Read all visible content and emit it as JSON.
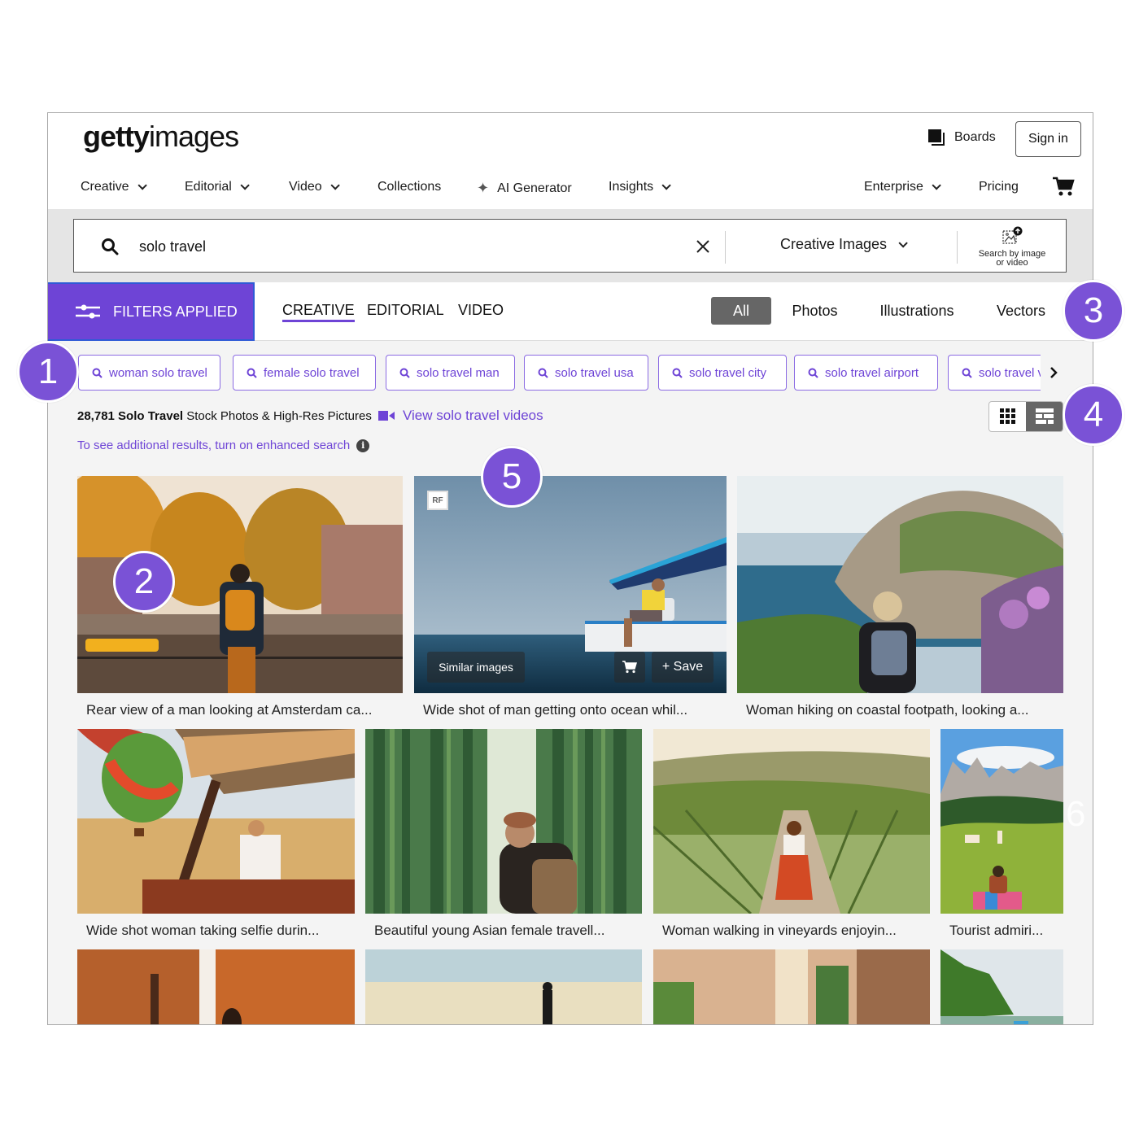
{
  "header": {
    "logo_bold": "getty",
    "logo_light": "images",
    "boards_label": "Boards",
    "signin_label": "Sign in"
  },
  "nav": {
    "items": [
      {
        "label": "Creative",
        "dropdown": true
      },
      {
        "label": "Editorial",
        "dropdown": true
      },
      {
        "label": "Video",
        "dropdown": true
      },
      {
        "label": "Collections",
        "dropdown": false
      },
      {
        "label": "AI Generator",
        "dropdown": false,
        "icon": "sparkle-icon"
      },
      {
        "label": "Insights",
        "dropdown": true
      }
    ],
    "right_items": [
      {
        "label": "Enterprise",
        "dropdown": true
      },
      {
        "label": "Pricing",
        "dropdown": false
      }
    ],
    "cart_icon": "cart-icon"
  },
  "search": {
    "query": "solo travel",
    "scope_label": "Creative Images",
    "search_by_image_label_1": "Search by image",
    "search_by_image_label_2": "or video"
  },
  "filters": {
    "filters_button_label": "FILTERS APPLIED",
    "content_tabs": [
      {
        "label": "CREATIVE",
        "active": true
      },
      {
        "label": "EDITORIAL",
        "active": false
      },
      {
        "label": "VIDEO",
        "active": false
      }
    ],
    "media_types": [
      {
        "label": "All",
        "active": true
      },
      {
        "label": "Photos",
        "active": false
      },
      {
        "label": "Illustrations",
        "active": false
      },
      {
        "label": "Vectors",
        "active": false
      }
    ]
  },
  "suggestions": [
    "woman solo travel",
    "female solo travel",
    "solo travel man",
    "solo travel usa",
    "solo travel city",
    "solo travel airport",
    "solo travel v"
  ],
  "results": {
    "count_bold": "28,781 Solo Travel",
    "count_rest": " Stock Photos & High-Res Pictures",
    "videos_link": "View solo travel videos",
    "enhanced_search_text": "To see additional results, turn on enhanced search",
    "info_glyph": "i",
    "accent_color": "#6e44d6"
  },
  "images": [
    {
      "caption": "Rear view of a man looking at Amsterdam ca..."
    },
    {
      "caption": "Wide shot of man getting onto ocean whil...",
      "badge": "RF",
      "similar_label": "Similar images",
      "save_label": "+ Save"
    },
    {
      "caption": "Woman hiking on coastal footpath, looking a..."
    },
    {
      "caption": "Wide shot woman taking selfie durin..."
    },
    {
      "caption": "Beautiful young Asian female travell..."
    },
    {
      "caption": "Woman walking in vineyards enjoyin..."
    },
    {
      "caption": "Tourist admiri..."
    },
    {
      "caption": ""
    },
    {
      "caption": ""
    },
    {
      "caption": ""
    },
    {
      "caption": ""
    }
  ],
  "callouts": [
    "1",
    "2",
    "3",
    "4",
    "5",
    "6"
  ]
}
